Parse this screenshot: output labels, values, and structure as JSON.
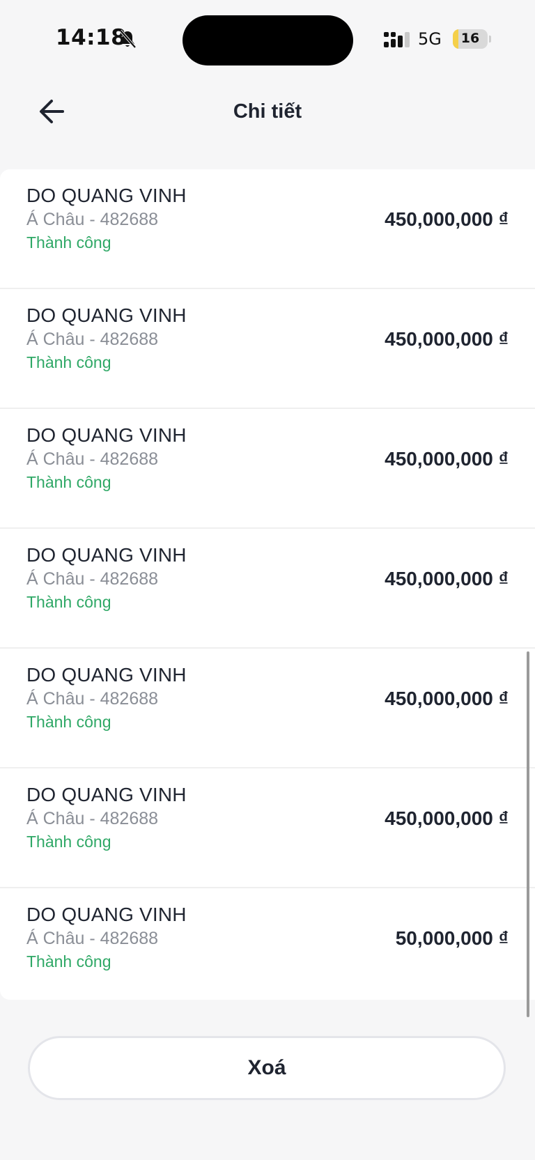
{
  "status_bar": {
    "time": "14:18",
    "network": "5G",
    "battery_level": "16",
    "battery_fraction": 0.16,
    "icons": [
      "bell-muted-icon",
      "signal-icon",
      "battery-icon"
    ]
  },
  "header": {
    "title": "Chi tiết",
    "back_icon": "arrow-left-icon"
  },
  "transactions": [
    {
      "name": "DO QUANG VINH",
      "bank": "Á Châu - 482688",
      "status": "Thành công",
      "amount": "450,000,000 ₫"
    },
    {
      "name": "DO QUANG VINH",
      "bank": "Á Châu - 482688",
      "status": "Thành công",
      "amount": "450,000,000 ₫"
    },
    {
      "name": "DO QUANG VINH",
      "bank": "Á Châu - 482688",
      "status": "Thành công",
      "amount": "450,000,000 ₫"
    },
    {
      "name": "DO QUANG VINH",
      "bank": "Á Châu - 482688",
      "status": "Thành công",
      "amount": "450,000,000 ₫"
    },
    {
      "name": "DO QUANG VINH",
      "bank": "Á Châu - 482688",
      "status": "Thành công",
      "amount": "450,000,000 ₫"
    },
    {
      "name": "DO QUANG VINH",
      "bank": "Á Châu - 482688",
      "status": "Thành công",
      "amount": "450,000,000 ₫"
    },
    {
      "name": "DO QUANG VINH",
      "bank": "Á Châu - 482688",
      "status": "Thành công",
      "amount": "50,000,000 ₫"
    }
  ],
  "footer": {
    "delete_label": "Xoá"
  },
  "colors": {
    "success": "#2fa866",
    "text_primary": "#1f2430",
    "text_secondary": "#8a8e96",
    "background": "#f6f6f7"
  }
}
